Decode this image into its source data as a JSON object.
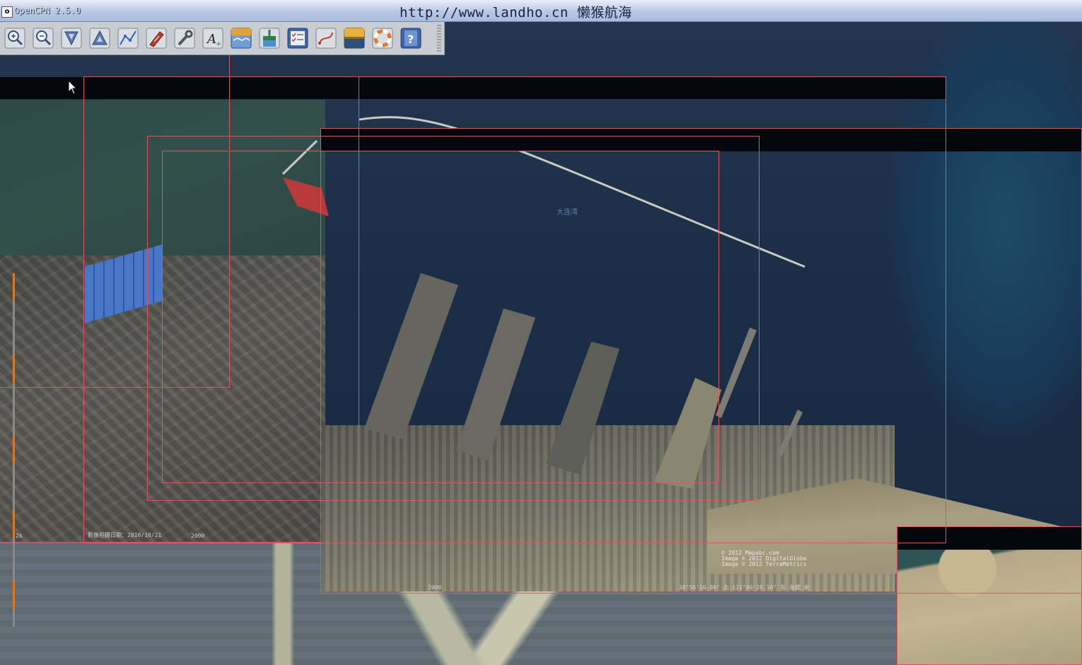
{
  "window": {
    "title": "OpenCPN 2.5.0",
    "watermark": "http://www.landho.cn 懒猴航海",
    "app_icon_glyph": "o"
  },
  "toolbar": {
    "buttons": [
      {
        "name": "zoom-in-button",
        "icon": "zoom-in-icon"
      },
      {
        "name": "zoom-out-button",
        "icon": "zoom-out-icon"
      },
      {
        "name": "scale-in-button",
        "icon": "scale-in-icon"
      },
      {
        "name": "scale-out-button",
        "icon": "scale-out-icon"
      },
      {
        "name": "route-button",
        "icon": "route-icon"
      },
      {
        "name": "auto-follow-button",
        "icon": "ship-icon"
      },
      {
        "name": "settings-button",
        "icon": "wrench-icon"
      },
      {
        "name": "text-button",
        "icon": "text-icon"
      },
      {
        "name": "current-button",
        "icon": "current-icon"
      },
      {
        "name": "tide-button",
        "icon": "tide-icon"
      },
      {
        "name": "route-manager-button",
        "icon": "checklist-icon"
      },
      {
        "name": "track-button",
        "icon": "track-icon"
      },
      {
        "name": "chart-quilt-button",
        "icon": "chart-icon"
      },
      {
        "name": "mob-button",
        "icon": "lifebuoy-icon"
      },
      {
        "name": "help-button",
        "icon": "help-icon"
      }
    ]
  },
  "chart": {
    "place_label": "大连湾",
    "left_image_caption": "影像拍摄日期：2010/10/21",
    "left_image_logo": "2000",
    "main_image_logo": "2000",
    "main_image_coords": "38°56'16.89\" 北 121°40'20.16\" 东 海拔  米",
    "left_scale_text": "2k",
    "credit_lines": [
      "© 2012 Mapabc.com",
      "Image © 2012 DigitalGlobe",
      "Image © 2012 TerraMetrics"
    ]
  },
  "colors": {
    "titlebar": "#b9c8e4",
    "toolbar": "#c9ccd1",
    "chart_outline": "#e0545c",
    "water": "#1b2e48"
  }
}
